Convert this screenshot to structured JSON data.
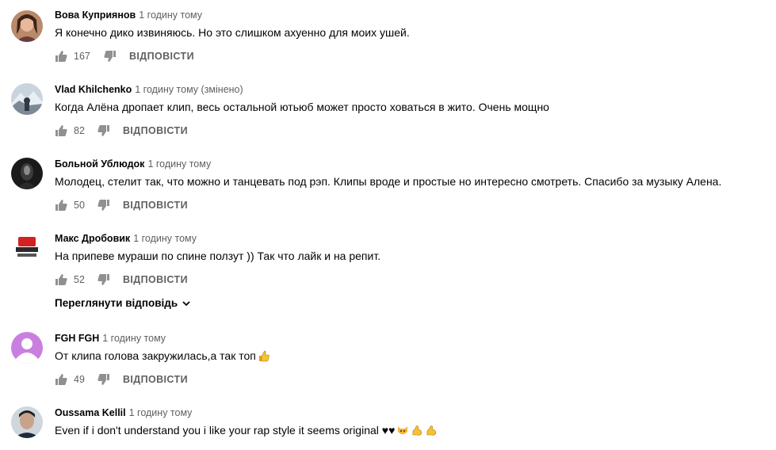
{
  "comments": [
    {
      "author": "Вова Куприянов",
      "time": "1 годину тому",
      "text": "Я конечно дико извиняюсь. Но это слишком ахуенно для моих ушей.",
      "likes": "167",
      "reply": "ВІДПОВІСТИ",
      "avatar": "woman-portrait-avatar"
    },
    {
      "author": "Vlad Khilchenko",
      "time": "1 годину тому (змінено)",
      "text": "Когда Алёна дропает клип, весь остальной ютьюб может просто ховаться в жито. Очень мощно",
      "likes": "82",
      "reply": "ВІДПОВІСТИ",
      "avatar": "mountain-photo-avatar"
    },
    {
      "author": "Больной Ублюдок",
      "time": "1 годину тому",
      "text": "Молодец, стелит так, что можно и танцевать под рэп. Клипы вроде и простые  но интересно смотреть. Спасибо за музыку Алена.",
      "likes": "50",
      "reply": "ВІДПОВІСТИ",
      "avatar": "dark-figure-avatar"
    },
    {
      "author": "Макс Дробовик",
      "time": "1 годину тому",
      "text": "На припеве мураши по спине ползут )) Так что лайк и на репит.",
      "likes": "52",
      "reply": "ВІДПОВІСТИ",
      "avatar": "red-logo-avatar",
      "view_replies": "Переглянути відповідь"
    },
    {
      "author": "FGH FGH",
      "time": "1 годину тому",
      "text": "От клипа голова закружилась,а так топ",
      "likes": "49",
      "reply": "ВІДПОВІСТИ",
      "avatar": "default-purple-avatar"
    },
    {
      "author": "Oussama Kellil",
      "time": "1 годину тому",
      "text": "Even if i don't understand you i like your rap style it seems original ♥♥",
      "avatar": "young-man-avatar"
    }
  ],
  "colors": {
    "secondary_text": "#606060",
    "primary_text": "#030303",
    "default_avatar": "#c97fe0"
  },
  "icons": {
    "like": "thumb-up-icon",
    "dislike": "thumb-down-icon",
    "expand": "chevron-down-icon"
  }
}
